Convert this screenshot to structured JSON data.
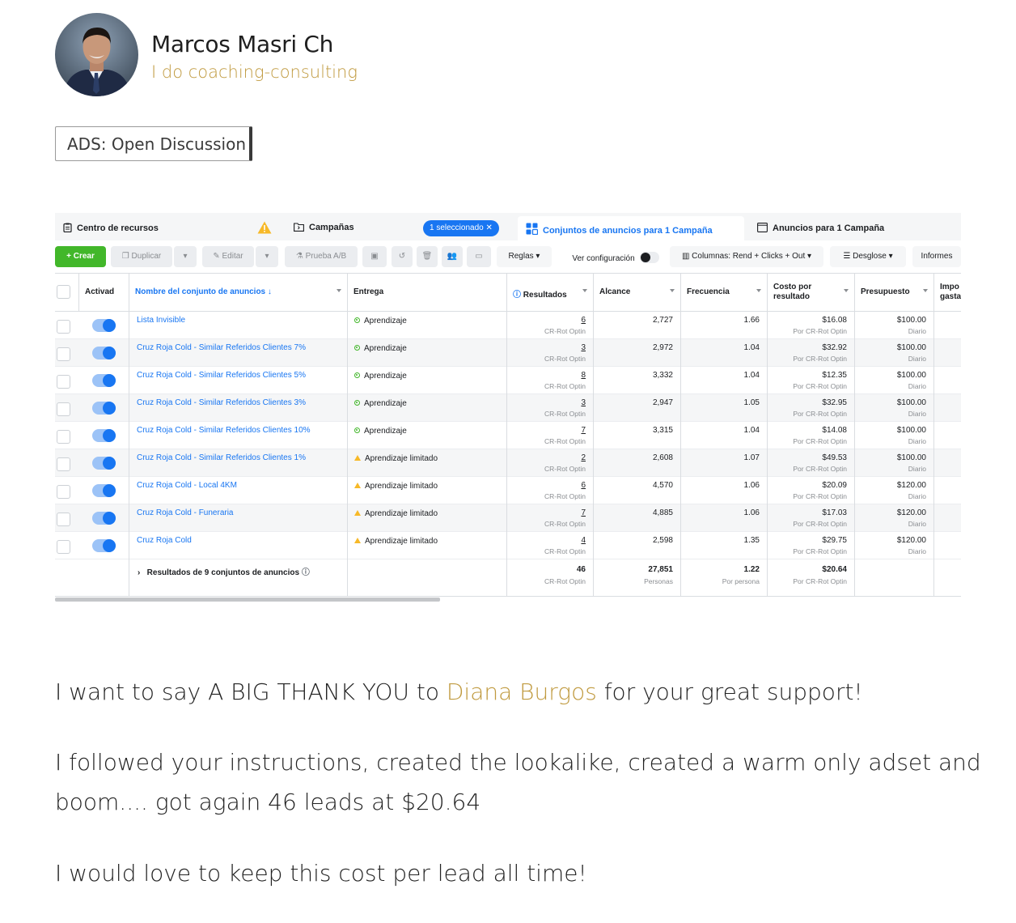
{
  "post": {
    "author": "Marcos Masri Ch",
    "author_subtitle": "I do coaching-consulting",
    "tag": "ADS: Open Discussion",
    "body": {
      "line1_before": "I want to say A BIG THANK YOU to",
      "mention": "Diana Burgos",
      "line1_after": "for your great support!",
      "para2_line1": "I followed your instructions, created the lookalike, created a warm only adset and",
      "para2_line2": "boom.... got again 46 leads at $20.64",
      "para3": "I would love to keep this cost per lead all time!"
    }
  },
  "ads_manager": {
    "tabs": {
      "resources": "Centro de recursos",
      "campaigns": "Campañas",
      "selected_chip": "1 seleccionado",
      "adsets": "Conjuntos de anuncios para 1 Campaña",
      "ads": "Anuncios para 1 Campaña"
    },
    "toolbar": {
      "create": "Crear",
      "duplicate": "Duplicar",
      "edit": "Editar",
      "ab_test": "Prueba A/B",
      "rules": "Reglas",
      "view_settings": "Ver configuración",
      "columns": "Columnas: Rend + Clicks + Out",
      "breakdown": "Desglose",
      "reports": "Informes"
    },
    "columns": {
      "active": "Activad",
      "name": "Nombre del conjunto de anuncios ↓",
      "delivery": "Entrega",
      "results": "Resultados",
      "reach": "Alcance",
      "frequency": "Frecuencia",
      "cost_line1": "Costo por",
      "cost_line2": "resultado",
      "budget": "Presupuesto",
      "spent_line1": "Impo",
      "spent_line2": "gasta"
    },
    "rows": [
      {
        "name": "Lista Invisible",
        "delivery": "Aprendizaje",
        "status": "learning",
        "results": "6",
        "results_sub": "CR-Rot Optin",
        "reach": "2,727",
        "frequency": "1.66",
        "cost": "$16.08",
        "cost_sub": "Por CR-Rot Optin",
        "budget": "$100.00",
        "budget_sub": "Diario"
      },
      {
        "name": "Cruz Roja Cold - Similar Referidos Clientes 7%",
        "delivery": "Aprendizaje",
        "status": "learning",
        "results": "3",
        "results_sub": "CR-Rot Optin",
        "reach": "2,972",
        "frequency": "1.04",
        "cost": "$32.92",
        "cost_sub": "Por CR-Rot Optin",
        "budget": "$100.00",
        "budget_sub": "Diario"
      },
      {
        "name": "Cruz Roja Cold - Similar Referidos Clientes 5%",
        "delivery": "Aprendizaje",
        "status": "learning",
        "results": "8",
        "results_sub": "CR-Rot Optin",
        "reach": "3,332",
        "frequency": "1.04",
        "cost": "$12.35",
        "cost_sub": "Por CR-Rot Optin",
        "budget": "$100.00",
        "budget_sub": "Diario"
      },
      {
        "name": "Cruz Roja Cold - Similar Referidos Clientes 3%",
        "delivery": "Aprendizaje",
        "status": "learning",
        "results": "3",
        "results_sub": "CR-Rot Optin",
        "reach": "2,947",
        "frequency": "1.05",
        "cost": "$32.95",
        "cost_sub": "Por CR-Rot Optin",
        "budget": "$100.00",
        "budget_sub": "Diario"
      },
      {
        "name": "Cruz Roja Cold - Similar Referidos Clientes 10%",
        "delivery": "Aprendizaje",
        "status": "learning",
        "results": "7",
        "results_sub": "CR-Rot Optin",
        "reach": "3,315",
        "frequency": "1.04",
        "cost": "$14.08",
        "cost_sub": "Por CR-Rot Optin",
        "budget": "$100.00",
        "budget_sub": "Diario"
      },
      {
        "name": "Cruz Roja Cold - Similar Referidos Clientes 1%",
        "delivery": "Aprendizaje limitado",
        "status": "limited",
        "results": "2",
        "results_sub": "CR-Rot Optin",
        "reach": "2,608",
        "frequency": "1.07",
        "cost": "$49.53",
        "cost_sub": "Por CR-Rot Optin",
        "budget": "$100.00",
        "budget_sub": "Diario"
      },
      {
        "name": "Cruz Roja Cold - Local 4KM",
        "delivery": "Aprendizaje limitado",
        "status": "limited",
        "results": "6",
        "results_sub": "CR-Rot Optin",
        "reach": "4,570",
        "frequency": "1.06",
        "cost": "$20.09",
        "cost_sub": "Por CR-Rot Optin",
        "budget": "$120.00",
        "budget_sub": "Diario"
      },
      {
        "name": "Cruz Roja Cold - Funeraria",
        "delivery": "Aprendizaje limitado",
        "status": "limited",
        "results": "7",
        "results_sub": "CR-Rot Optin",
        "reach": "4,885",
        "frequency": "1.06",
        "cost": "$17.03",
        "cost_sub": "Por CR-Rot Optin",
        "budget": "$120.00",
        "budget_sub": "Diario"
      },
      {
        "name": "Cruz Roja Cold",
        "delivery": "Aprendizaje limitado",
        "status": "limited",
        "results": "4",
        "results_sub": "CR-Rot Optin",
        "reach": "2,598",
        "frequency": "1.35",
        "cost": "$29.75",
        "cost_sub": "Por CR-Rot Optin",
        "budget": "$120.00",
        "budget_sub": "Diario"
      }
    ],
    "totals": {
      "label": "Resultados de 9 conjuntos de anuncios",
      "results": "46",
      "results_sub": "CR-Rot Optin",
      "reach": "27,851",
      "reach_sub": "Personas",
      "frequency": "1.22",
      "frequency_sub": "Por persona",
      "cost": "$20.64",
      "cost_sub": "Por CR-Rot Optin"
    }
  },
  "colors": {
    "accent_gold": "#c09a3f",
    "fb_blue": "#1876f2",
    "create_green": "#42b72a",
    "warning_yellow": "#f7b928"
  }
}
